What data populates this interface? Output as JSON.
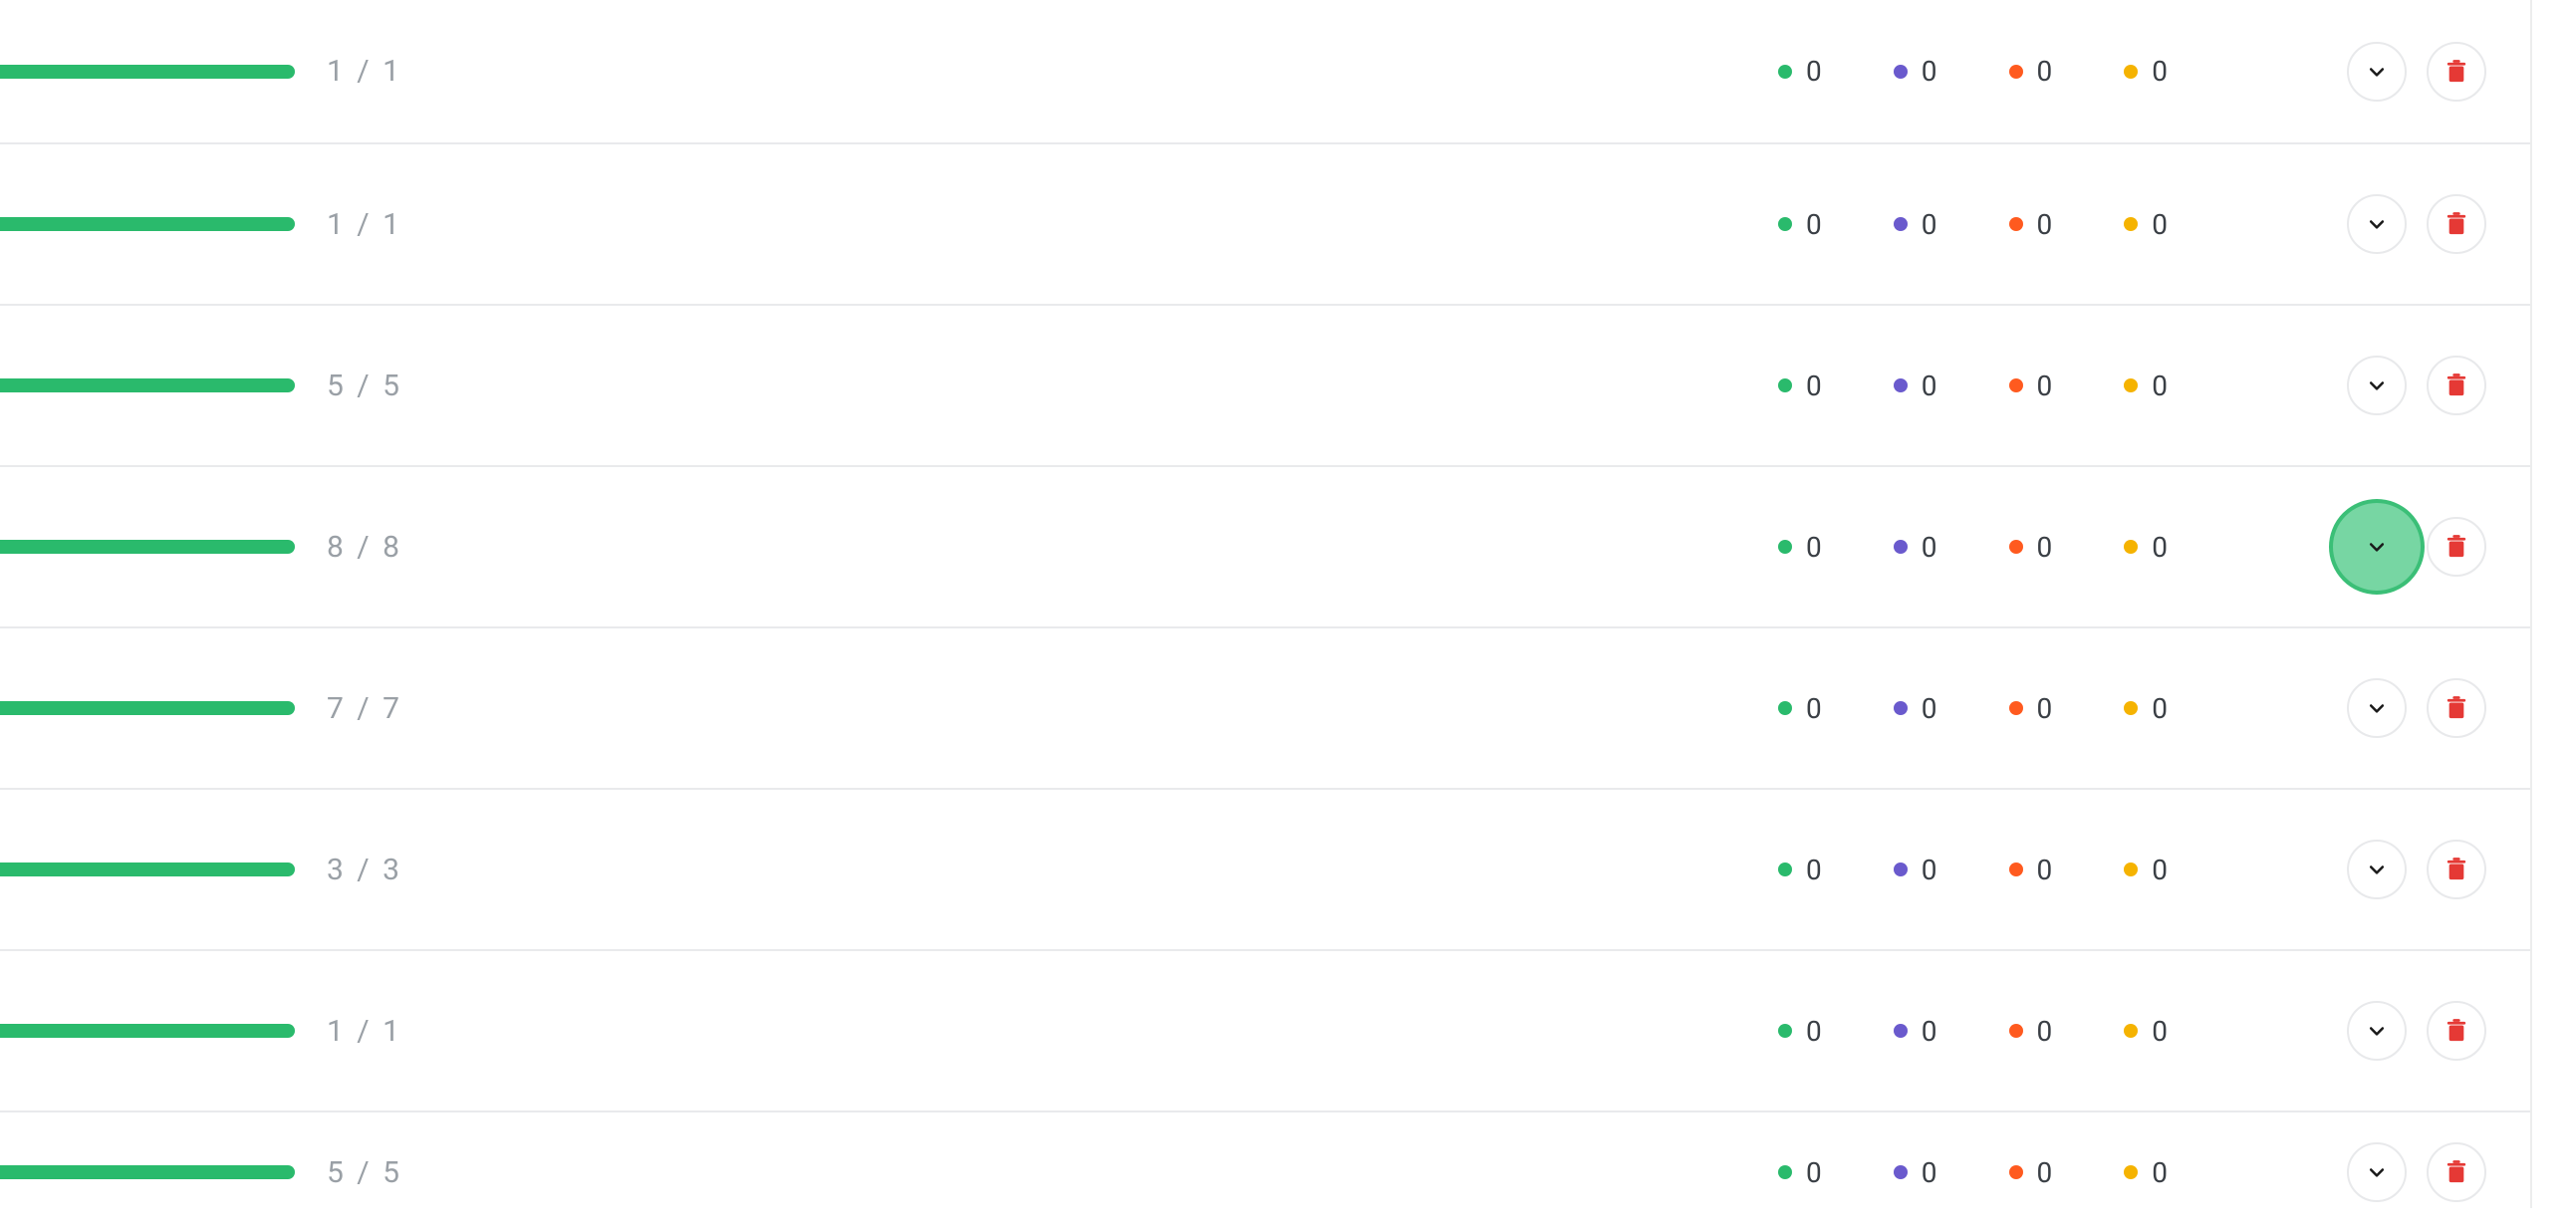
{
  "colors": {
    "progress": "#2aba6c",
    "stat_green": "#2aba6c",
    "stat_purple": "#6a5acd",
    "stat_orange": "#ff5a1f",
    "stat_yellow": "#f5b301",
    "delete": "#e53935",
    "highlight_bg": "#77d6a3",
    "highlight_border": "#3bbf77"
  },
  "rows": [
    {
      "done": 1,
      "total": 1,
      "ratio": "1 / 1",
      "s1": 0,
      "s2": 0,
      "s3": 0,
      "s4": 0,
      "expand_highlight": false
    },
    {
      "done": 1,
      "total": 1,
      "ratio": "1 / 1",
      "s1": 0,
      "s2": 0,
      "s3": 0,
      "s4": 0,
      "expand_highlight": false
    },
    {
      "done": 5,
      "total": 5,
      "ratio": "5 / 5",
      "s1": 0,
      "s2": 0,
      "s3": 0,
      "s4": 0,
      "expand_highlight": false
    },
    {
      "done": 8,
      "total": 8,
      "ratio": "8 / 8",
      "s1": 0,
      "s2": 0,
      "s3": 0,
      "s4": 0,
      "expand_highlight": true
    },
    {
      "done": 7,
      "total": 7,
      "ratio": "7 / 7",
      "s1": 0,
      "s2": 0,
      "s3": 0,
      "s4": 0,
      "expand_highlight": false
    },
    {
      "done": 3,
      "total": 3,
      "ratio": "3 / 3",
      "s1": 0,
      "s2": 0,
      "s3": 0,
      "s4": 0,
      "expand_highlight": false
    },
    {
      "done": 1,
      "total": 1,
      "ratio": "1 / 1",
      "s1": 0,
      "s2": 0,
      "s3": 0,
      "s4": 0,
      "expand_highlight": false
    },
    {
      "done": 5,
      "total": 5,
      "ratio": "5 / 5",
      "s1": 0,
      "s2": 0,
      "s3": 0,
      "s4": 0,
      "expand_highlight": false
    }
  ]
}
